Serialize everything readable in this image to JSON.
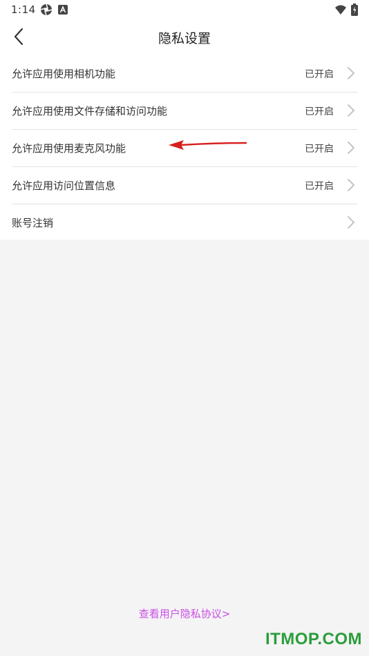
{
  "status_bar": {
    "time": "1:14",
    "icons": [
      "aperture-icon",
      "a-badge-icon",
      "wifi-icon",
      "battery-icon"
    ]
  },
  "header": {
    "title": "隐私设置",
    "back_icon": "chevron-left-icon"
  },
  "settings": [
    {
      "label": "允许应用使用相机功能",
      "status": "已开启"
    },
    {
      "label": "允许应用使用文件存储和访问功能",
      "status": "已开启"
    },
    {
      "label": "允许应用使用麦克风功能",
      "status": "已开启"
    },
    {
      "label": "允许应用访问位置信息",
      "status": "已开启"
    },
    {
      "label": "账号注销",
      "status": ""
    }
  ],
  "footer": {
    "agreement_link": "查看用户隐私协议>"
  },
  "watermark": {
    "text": "ITMOP.COM"
  },
  "colors": {
    "background": "#f4f4f4",
    "link": "#c94de6",
    "watermark": "#2a9d3a",
    "annotation_arrow": "#d81e1e"
  }
}
